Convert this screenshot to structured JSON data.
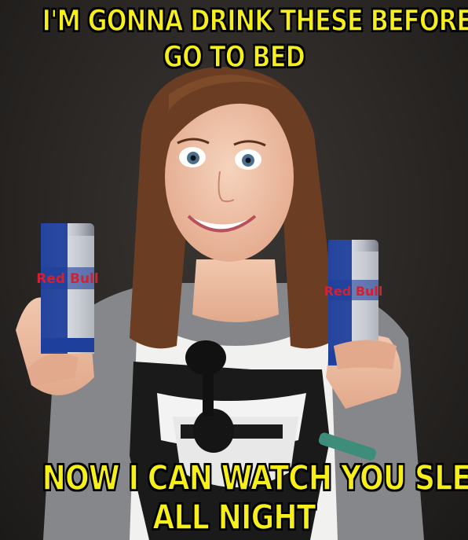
{
  "meme": {
    "top_caption": [
      "I'M GONNA DRINK THESE BEFORE YOU",
      "GO TO BED"
    ],
    "bottom_caption": [
      "NOW I CAN WATCH YOU SLEEP",
      "ALL NIGHT"
    ],
    "can_brand": "Red Bull",
    "colors": {
      "caption_fill": "#f6ef1c",
      "caption_outline": "#000000",
      "background": "#2c2926",
      "can_blue": "#1f3f9c",
      "can_silver": "#c9ccd3",
      "can_red": "#d1222e",
      "hair": "#6b3d22",
      "shirt": "#f2f2f2",
      "cardigan": "#8a8b8e"
    }
  }
}
